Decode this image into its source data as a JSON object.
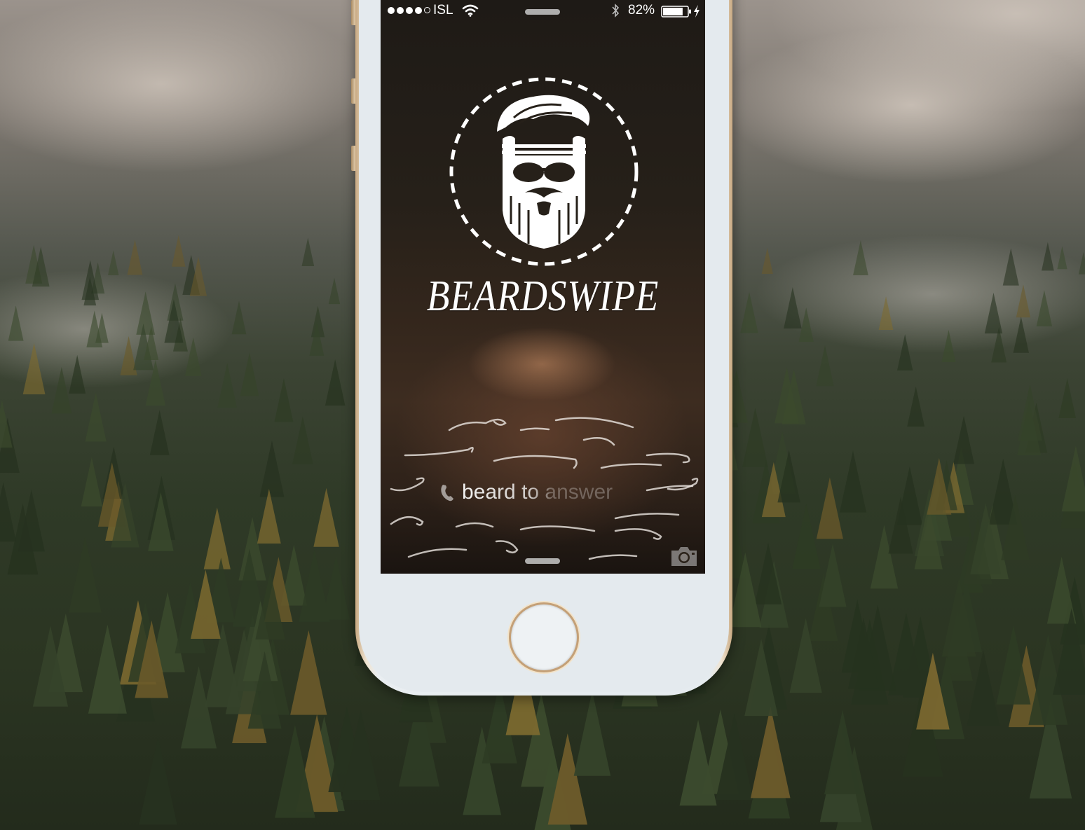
{
  "status_bar": {
    "carrier": "ISL",
    "signal_bars": 4,
    "signal_max": 5,
    "battery_percent": "82%",
    "battery_level": 0.82,
    "icons": [
      "wifi-icon",
      "bluetooth-icon",
      "battery-icon",
      "charging-bolt-icon"
    ]
  },
  "lock_screen": {
    "brand": "BEARDSWIPE",
    "slide_prefix": "beard",
    "slide_suffix": " to answer",
    "icons": [
      "bearded-face-logo-icon",
      "phone-icon",
      "camera-icon"
    ]
  },
  "colors": {
    "text": "#ffffff",
    "phone_body": "#e4eaee",
    "phone_trim": "#c8a982"
  }
}
